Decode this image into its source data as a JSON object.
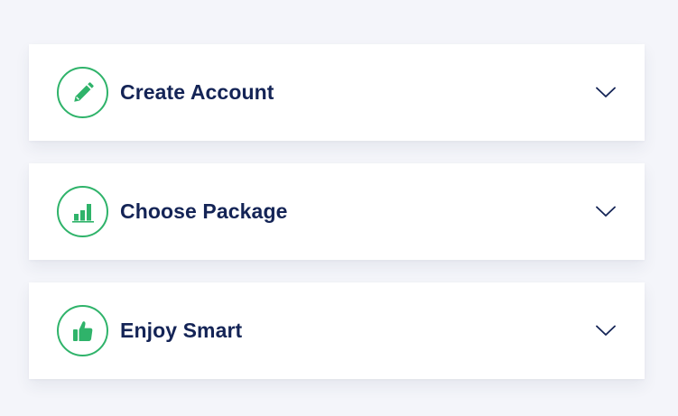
{
  "accordion": {
    "items": [
      {
        "title": "Create Account",
        "icon": "pencil-icon"
      },
      {
        "title": "Choose Package",
        "icon": "bar-chart-icon"
      },
      {
        "title": "Enjoy Smart",
        "icon": "thumbs-up-icon"
      }
    ]
  },
  "colors": {
    "background": "#f4f5fa",
    "card": "#ffffff",
    "accent": "#2fb36a",
    "title": "#142456"
  }
}
